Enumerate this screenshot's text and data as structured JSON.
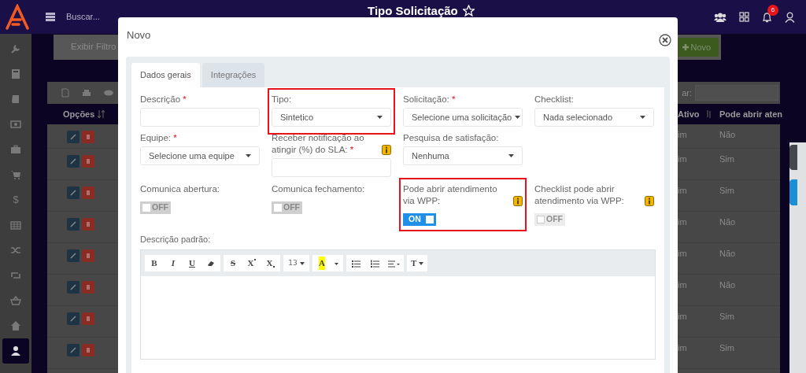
{
  "topbar": {
    "search_placeholder": "Buscar...",
    "title": "Tipo Solicitação",
    "notification_count": "6"
  },
  "sidebar": {
    "items": [
      {
        "selected": false
      },
      {
        "selected": false
      },
      {
        "selected": false
      },
      {
        "selected": false
      },
      {
        "selected": false
      },
      {
        "selected": false
      },
      {
        "label": "$",
        "selected": false
      },
      {
        "selected": false
      },
      {
        "selected": false
      },
      {
        "selected": false
      },
      {
        "selected": false
      },
      {
        "selected": false
      },
      {
        "selected": true
      }
    ]
  },
  "filter_bar": {
    "toggle_label": "Exibir Filtro",
    "new_button": "Novo"
  },
  "table": {
    "search_label": "ar:",
    "columns": [
      "Opções",
      "Ativo",
      "Pode abrir aten"
    ],
    "rows": [
      {
        "ativo": "im",
        "pode_abrir": "Não"
      },
      {
        "ativo": "im",
        "pode_abrir": "Sim"
      },
      {
        "ativo": "im",
        "pode_abrir": "Sim"
      },
      {
        "ativo": "im",
        "pode_abrir": "Não"
      },
      {
        "ativo": "im",
        "pode_abrir": "Não"
      },
      {
        "ativo": "im",
        "pode_abrir": "Não"
      },
      {
        "ativo": "im",
        "pode_abrir": "Sim"
      },
      {
        "ativo": "im",
        "pode_abrir": "Sim"
      }
    ]
  },
  "modal": {
    "title": "Novo",
    "tabs": [
      {
        "label": "Dados gerais",
        "selected": true
      },
      {
        "label": "Integrações",
        "selected": false
      }
    ],
    "rows": [
      [
        {
          "kind": "text",
          "label": "Descrição",
          "required_mark": "*",
          "highlighted": false
        },
        {
          "kind": "select",
          "label": "Tipo:",
          "value": "Sintetico",
          "highlighted": true
        },
        {
          "kind": "select",
          "label": "Solicitação:",
          "required_mark": "*",
          "value": "Selecione uma solicitação",
          "highlighted": false
        },
        {
          "kind": "select",
          "label": "Checklist:",
          "value": "Nada selecionado",
          "highlighted": false
        }
      ],
      [
        {
          "kind": "select",
          "label": "Equipe:",
          "required_mark": "*",
          "value": "Selecione uma equipe",
          "highlighted": false
        },
        {
          "kind": "text",
          "label": "Receber notificação ao atingir (%) do SLA:",
          "required_mark": "*",
          "info": true,
          "highlighted": false
        },
        {
          "kind": "select",
          "label": "Pesquisa de satisfação:",
          "value": "Nenhuma",
          "highlighted": false
        }
      ],
      [
        {
          "kind": "toggle",
          "label": "Comunica abertura:",
          "on": false,
          "disabled": false,
          "state_label": "OFF",
          "highlighted": false
        },
        {
          "kind": "toggle",
          "label": "Comunica fechamento:",
          "on": false,
          "disabled": false,
          "state_label": "OFF",
          "highlighted": false
        },
        {
          "kind": "toggle",
          "label": "Pode abrir atendimento via WPP:",
          "info": true,
          "on": true,
          "disabled": false,
          "state_label": "ON",
          "highlighted": true
        },
        {
          "kind": "toggle",
          "label": "Checklist pode abrir atendimento via WPP:",
          "info": true,
          "on": false,
          "disabled": true,
          "state_label": "OFF",
          "highlighted": false
        }
      ]
    ],
    "editor": {
      "label": "Descrição padrão:",
      "tool_groups": [
        [
          {
            "kind": "bold",
            "label": "B"
          },
          {
            "kind": "italic",
            "label": "I"
          },
          {
            "kind": "underline",
            "label": "U"
          },
          {
            "kind": "eraser"
          }
        ],
        [
          {
            "kind": "strike",
            "label": "S"
          },
          {
            "kind": "superscript",
            "label": "X"
          },
          {
            "kind": "subscript",
            "label": "X"
          }
        ],
        [
          {
            "kind": "dropdown",
            "label": "13"
          }
        ],
        [
          {
            "kind": "color",
            "label": "A"
          },
          {
            "kind": "caret"
          }
        ],
        [
          {
            "kind": "bullet-list"
          },
          {
            "kind": "number-list"
          },
          {
            "kind": "align"
          }
        ],
        [
          {
            "kind": "height",
            "label": "T"
          }
        ]
      ]
    }
  }
}
